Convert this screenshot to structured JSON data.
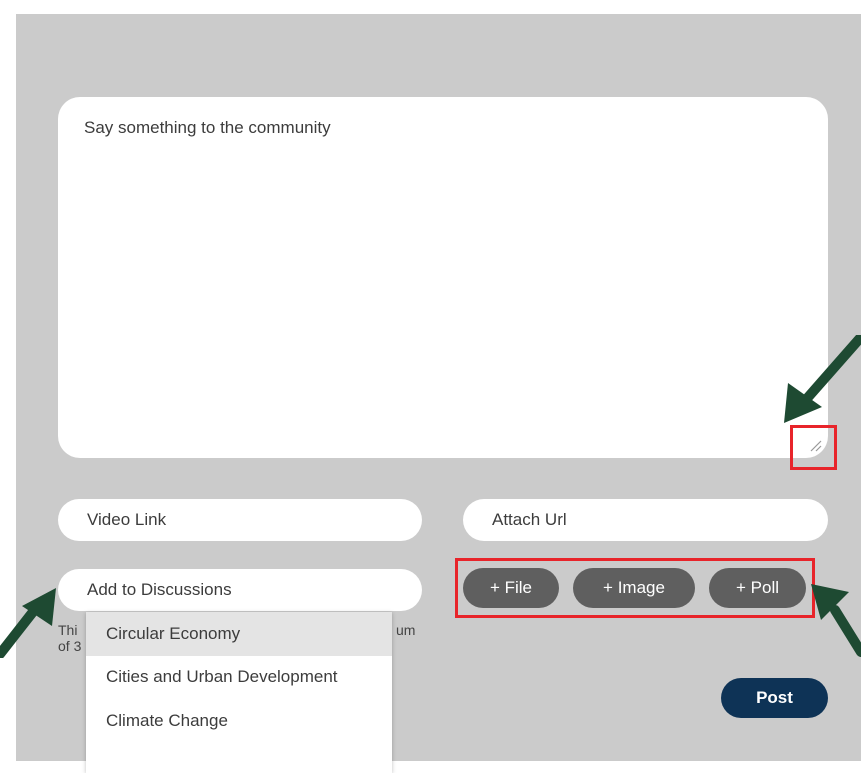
{
  "composer": {
    "placeholder": "Say something to the community"
  },
  "fields": {
    "video_link": "Video Link",
    "attach_url": "Attach Url",
    "add_discussions": "Add to Discussions"
  },
  "attachments": {
    "file": "+ File",
    "image": "+ Image",
    "poll": "+ Poll"
  },
  "post_label": "Post",
  "helper": {
    "left_line1": "Thi",
    "left_line2": "of 3",
    "right_line1": "um"
  },
  "dropdown": {
    "options": [
      "Circular Economy",
      "Cities and Urban Development",
      "Climate Change"
    ]
  },
  "colors": {
    "panel": "#cbcbcb",
    "highlight": "#e8242a",
    "arrow": "#1e4a32",
    "post": "#0e3356",
    "pill_button": "#5f5f5f"
  }
}
